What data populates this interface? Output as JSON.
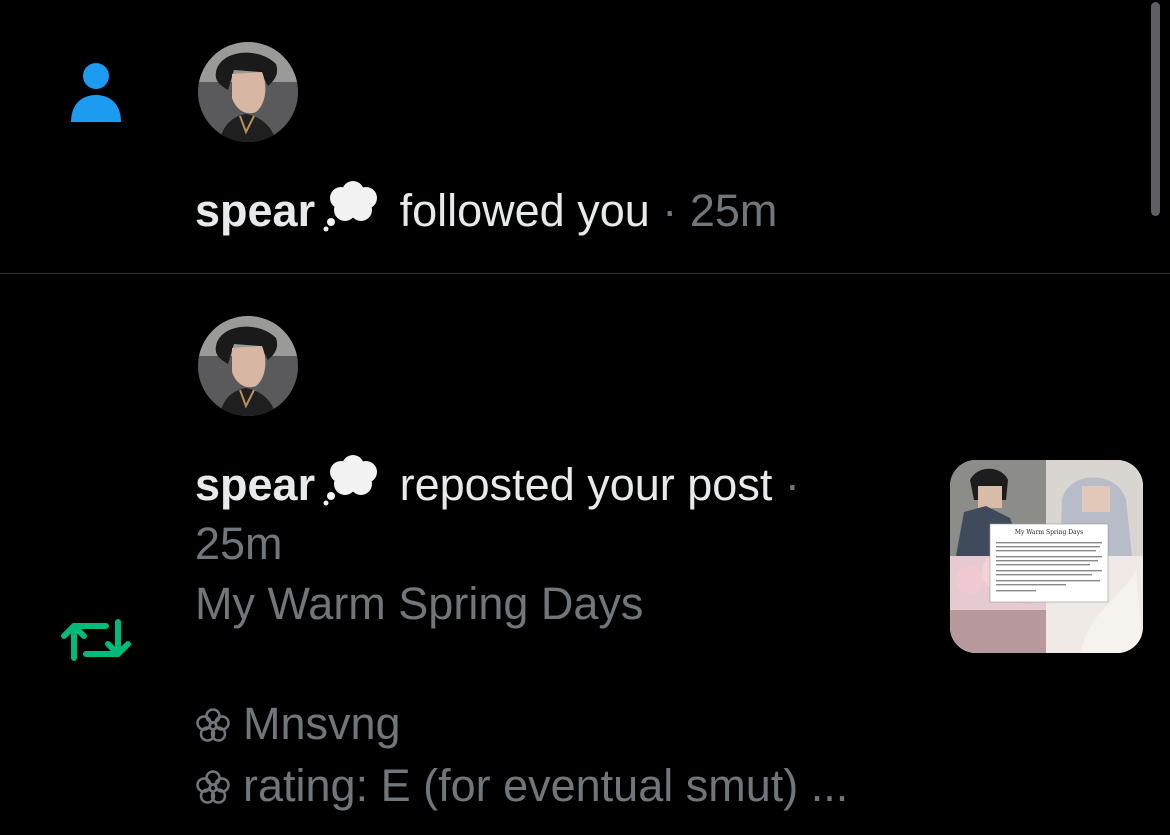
{
  "notifications": [
    {
      "type": "follow",
      "icon": "person-icon",
      "icon_color": "#1d9bf0",
      "user": "spear",
      "user_emoji": "thought-balloon-emoji",
      "action": "followed you",
      "separator": "·",
      "time": "25m"
    },
    {
      "type": "repost",
      "icon": "repost-icon",
      "icon_color": "#00ba7c",
      "user": "spear",
      "user_emoji": "thought-balloon-emoji",
      "action": "reposted your post",
      "separator": "·",
      "time": "25m",
      "post_title": "My Warm Spring Days",
      "post_lines": [
        "Mnsvng",
        "rating: E (for eventual smut) ..."
      ],
      "line_bullet_icon": "flower-icon",
      "thumbnail_title": "My Warm Spring Days"
    }
  ],
  "colors": {
    "background": "#000000",
    "primary_text": "#e7e9ea",
    "secondary_text": "#71767b",
    "divider": "#2f3336"
  }
}
